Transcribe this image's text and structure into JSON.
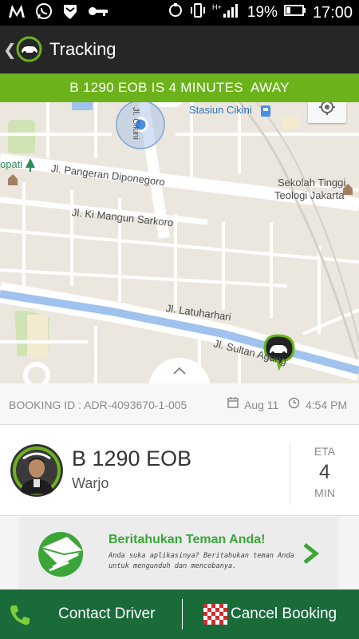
{
  "status_bar": {
    "battery": "19%",
    "time": "17:00",
    "network": "H+"
  },
  "app_bar": {
    "title": "Tracking"
  },
  "eta_banner": {
    "text": "B 1290 EOB IS 4 MINUTES  AWAY"
  },
  "map": {
    "labels": {
      "station": "Stasiun Cikini",
      "school_line1": "Sekolah Tinggi",
      "school_line2": "Teologi Jakarta",
      "street1": "Jl. Pangeran Diponegoro",
      "street2": "Jl. Ki Mangun Sarkoro",
      "street3": "Jl. Latuharhari",
      "street4": "Jl. Sultan Agung",
      "street5": "Jl. Cikini",
      "left_poi": "opati"
    }
  },
  "booking": {
    "id_text": "BOOKING ID : ADR-4093670-1-005",
    "date": "Aug 11",
    "time": "4:54 PM"
  },
  "driver": {
    "plate": "B 1290 EOB",
    "name": "Warjo",
    "eta_label": "ETA",
    "eta_value": "4",
    "eta_unit": "MIN"
  },
  "promo": {
    "title": "Beritahukan Teman Anda!",
    "text": "Anda suka aplikasinya? Beritahukan teman Anda untuk mengunduh dan mencobanya."
  },
  "bottom_bar": {
    "contact_label": "Contact Driver",
    "cancel_label": "Cancel Booking"
  },
  "colors": {
    "green_banner": "#6cb31b",
    "bottom_bar": "#1a6b3a",
    "promo_green": "#3ba638"
  }
}
